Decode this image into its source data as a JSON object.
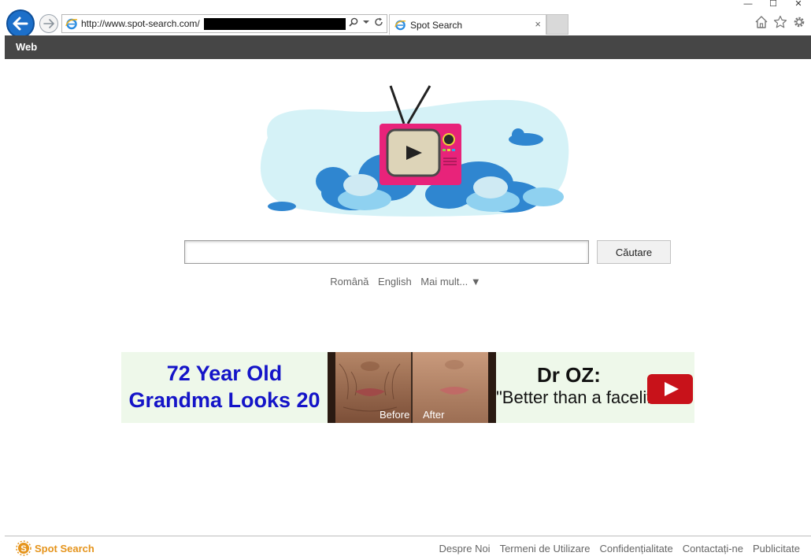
{
  "browser": {
    "url": "http://www.spot-search.com/",
    "tab_title": "Spot Search",
    "tab_close": "×",
    "window_controls": [
      "—",
      "☐",
      "✕"
    ],
    "icons": [
      "back-arrow-icon",
      "forward-arrow-icon",
      "ie-logo-icon",
      "search-icon",
      "dropdown-icon",
      "refresh-icon",
      "home-icon",
      "star-icon",
      "gear-icon"
    ]
  },
  "topbar": {
    "web_label": "Web"
  },
  "search": {
    "button_label": "Căutare",
    "value": ""
  },
  "languages": {
    "items": [
      "Română",
      "English",
      "Mai mult... ▼"
    ]
  },
  "ad": {
    "left_line1": "72 Year Old",
    "left_line2": "Grandma Looks 20",
    "caption_before": "Before",
    "caption_after": "After",
    "right_title": "Dr OZ:",
    "right_subtitle": "\"Better than a facelift\""
  },
  "footer": {
    "logo_text": "Spot Search",
    "links": [
      "Despre Noi",
      "Termeni de Utilizare",
      "Confidențialitate",
      "Contactați-ne",
      "Publicitate"
    ]
  },
  "colors": {
    "browser_blue": "#1c6fc9",
    "topbar": "#464646",
    "ad_left_text": "#1414c8",
    "ad_background": "#eef8ea",
    "tv_pink": "#e8237a",
    "cloud_blue": "#2f86d0",
    "logo_orange": "#e5941c"
  }
}
